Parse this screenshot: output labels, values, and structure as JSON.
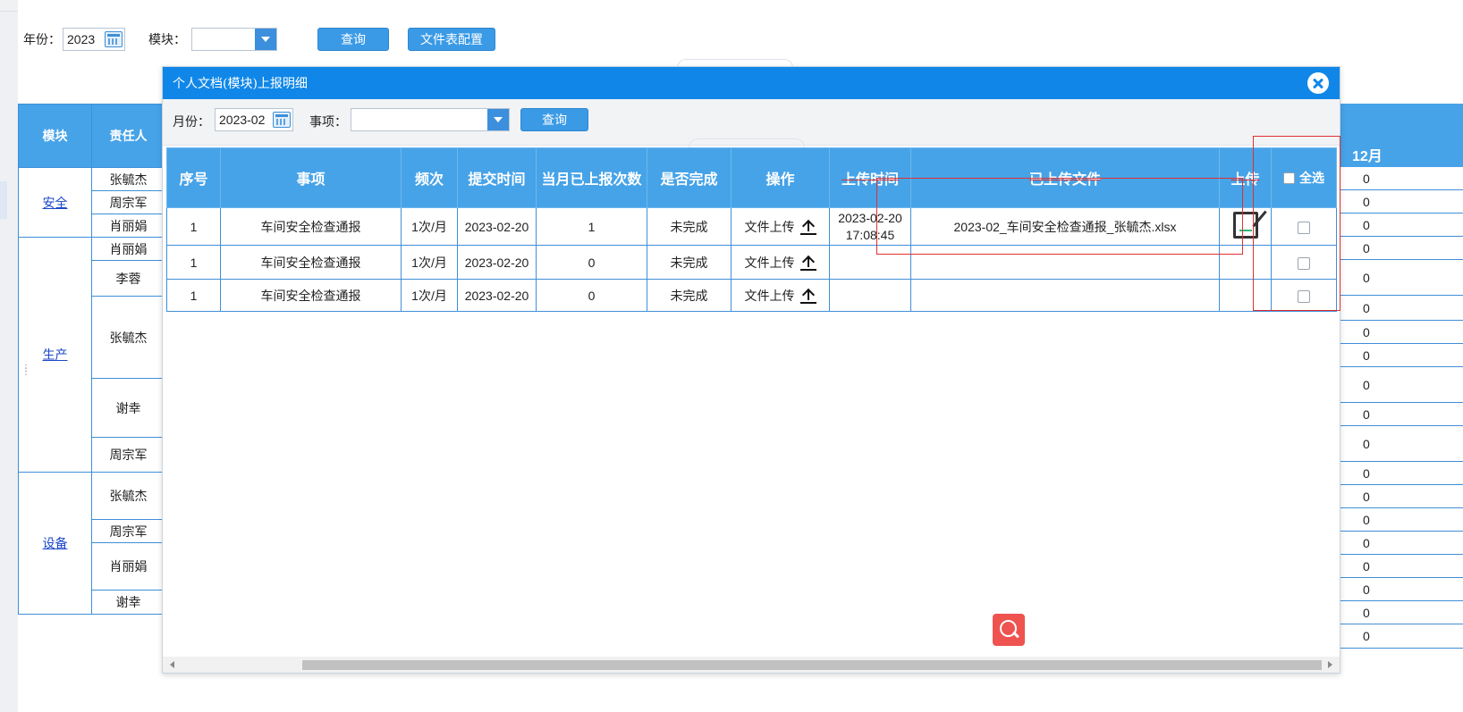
{
  "filter": {
    "year_label": "年份：",
    "year_value": "2023",
    "module_label": "模块：",
    "module_value": "",
    "query_label": "查询",
    "config_label": "文件表配置"
  },
  "matrix": {
    "head_module": "模块",
    "head_owner": "责任人",
    "head_month": "12月",
    "groups": [
      {
        "module": "安全",
        "owners": [
          "张毓杰",
          "周宗军",
          "肖丽娟"
        ]
      },
      {
        "module": "生产",
        "owners": [
          "肖丽娟",
          "李蓉",
          "张毓杰",
          "谢幸",
          "周宗军"
        ]
      },
      {
        "module": "设备",
        "owners": [
          "张毓杰",
          "周宗军",
          "肖丽娟",
          "谢幸"
        ]
      }
    ],
    "month_values": [
      "0",
      "0",
      "0",
      "0",
      "0",
      "0",
      "0",
      "0",
      "0",
      "0",
      "0",
      "0",
      "0",
      "0",
      "0",
      "0",
      "0",
      "0",
      "0"
    ]
  },
  "modal": {
    "title": "个人文档(模块)上报明细",
    "month_label": "月份：",
    "month_value": "2023-02",
    "item_label": "事项：",
    "item_value": "",
    "query_label": "查询",
    "columns": [
      "序号",
      "事项",
      "频次",
      "提交时间",
      "当月已上报次数",
      "是否完成",
      "操作",
      "上传时间",
      "已上传文件",
      "上传",
      "全选"
    ],
    "rows": [
      {
        "no": "1",
        "item": "车间安全检查通报",
        "freq": "1次/月",
        "submit": "2023-02-20",
        "count": "1",
        "done": "未完成",
        "op": "文件上传",
        "upload_date": "2023-02-20",
        "upload_time": "17:08:45",
        "file": "2023-02_车间安全检查通报_张毓杰.xlsx",
        "has_edit": true
      },
      {
        "no": "1",
        "item": "车间安全检查通报",
        "freq": "1次/月",
        "submit": "2023-02-20",
        "count": "0",
        "done": "未完成",
        "op": "文件上传",
        "upload_date": "",
        "upload_time": "",
        "file": "",
        "has_edit": false
      },
      {
        "no": "1",
        "item": "车间安全检查通报",
        "freq": "1次/月",
        "submit": "2023-02-20",
        "count": "0",
        "done": "未完成",
        "op": "文件上传",
        "upload_date": "",
        "upload_time": "",
        "file": "",
        "has_edit": false
      }
    ]
  },
  "colors": {
    "accent": "#1087e8",
    "header": "#46a3e8",
    "annotation": "#e03030",
    "fab": "#ef5350"
  }
}
